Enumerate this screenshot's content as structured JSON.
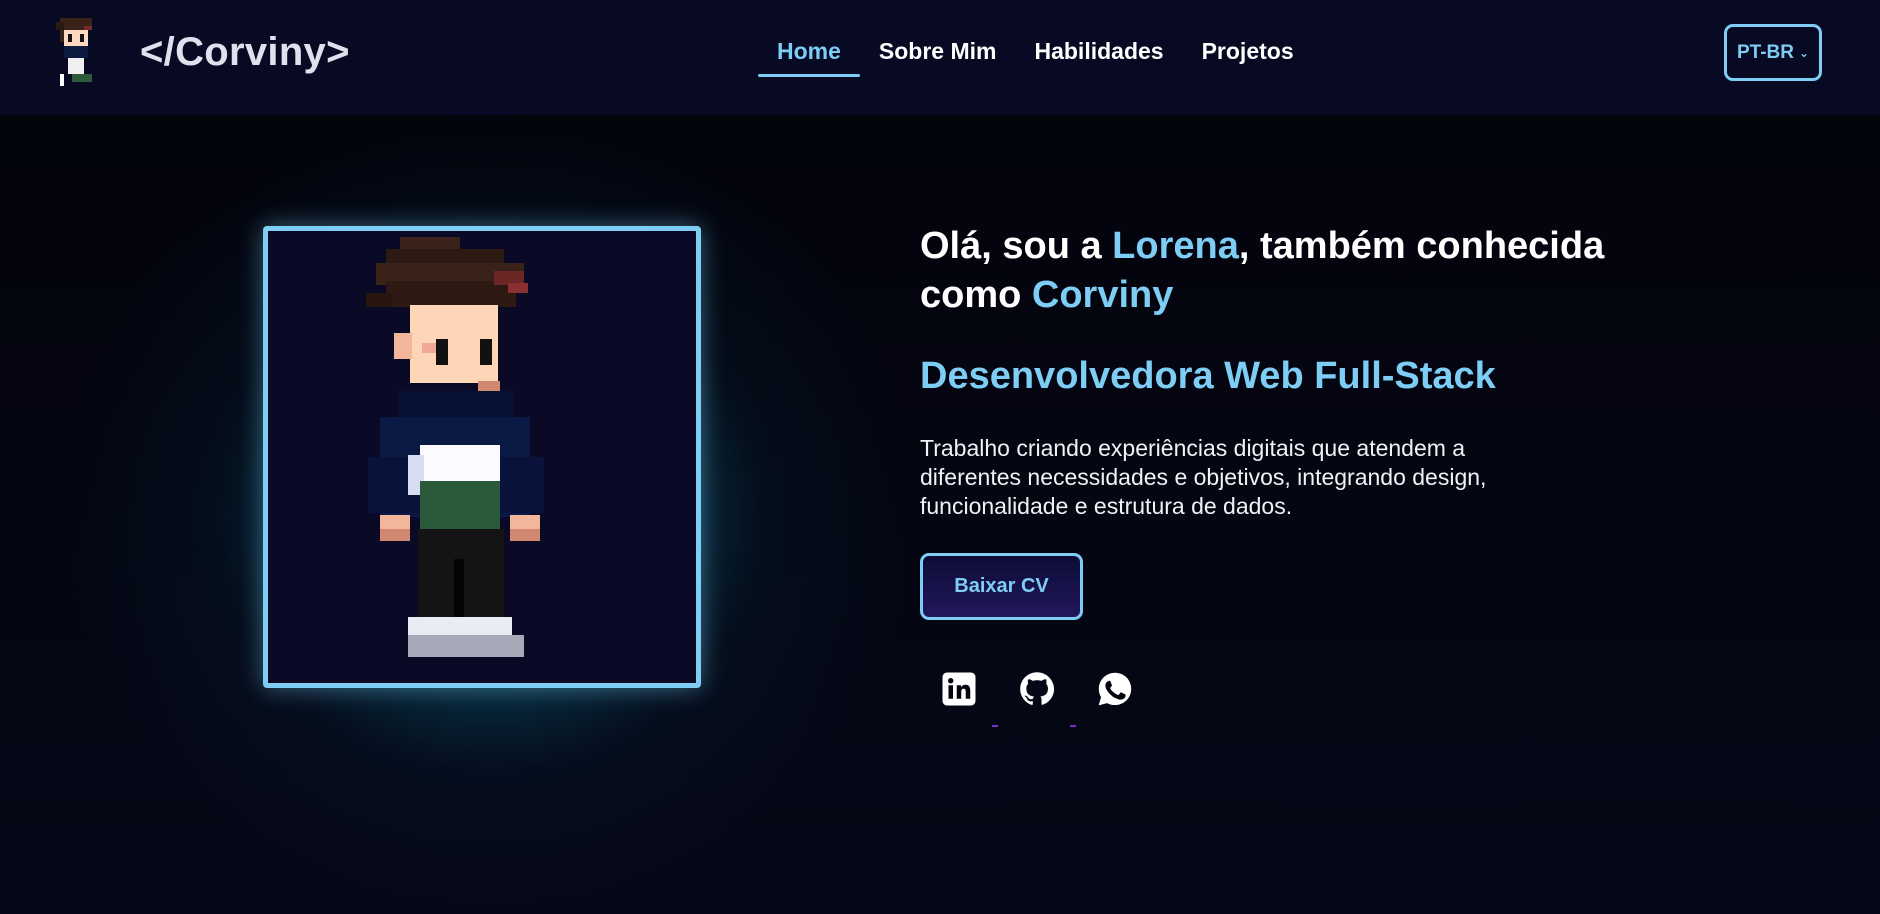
{
  "header": {
    "brand_name": "</Corviny>",
    "nav": [
      {
        "label": "Home",
        "active": true
      },
      {
        "label": "Sobre Mim",
        "active": false
      },
      {
        "label": "Habilidades",
        "active": false
      },
      {
        "label": "Projetos",
        "active": false
      }
    ],
    "language": {
      "selected": "PT-BR",
      "icon": "chevron-down-icon"
    }
  },
  "hero": {
    "greeting_part1": "Olá, sou a ",
    "name": "Lorena",
    "greeting_part2": ", também conhecida como ",
    "nickname": "Corviny",
    "role": "Desenvolvedora Web Full-Stack",
    "description": "Trabalho criando experiências digitais que atendem a diferentes necessidades e objetivos, integrando design, funcionalidade e estrutura de dados.",
    "cv_button": "Baixar CV"
  },
  "socials": [
    {
      "name": "linkedin",
      "icon": "linkedin-icon"
    },
    {
      "name": "github",
      "icon": "github-icon"
    },
    {
      "name": "whatsapp",
      "icon": "whatsapp-icon"
    }
  ],
  "colors": {
    "accent": "#7dcdf5",
    "header_bg": "#080a24",
    "page_bg": "#030410",
    "glow": "#0f96aa"
  }
}
